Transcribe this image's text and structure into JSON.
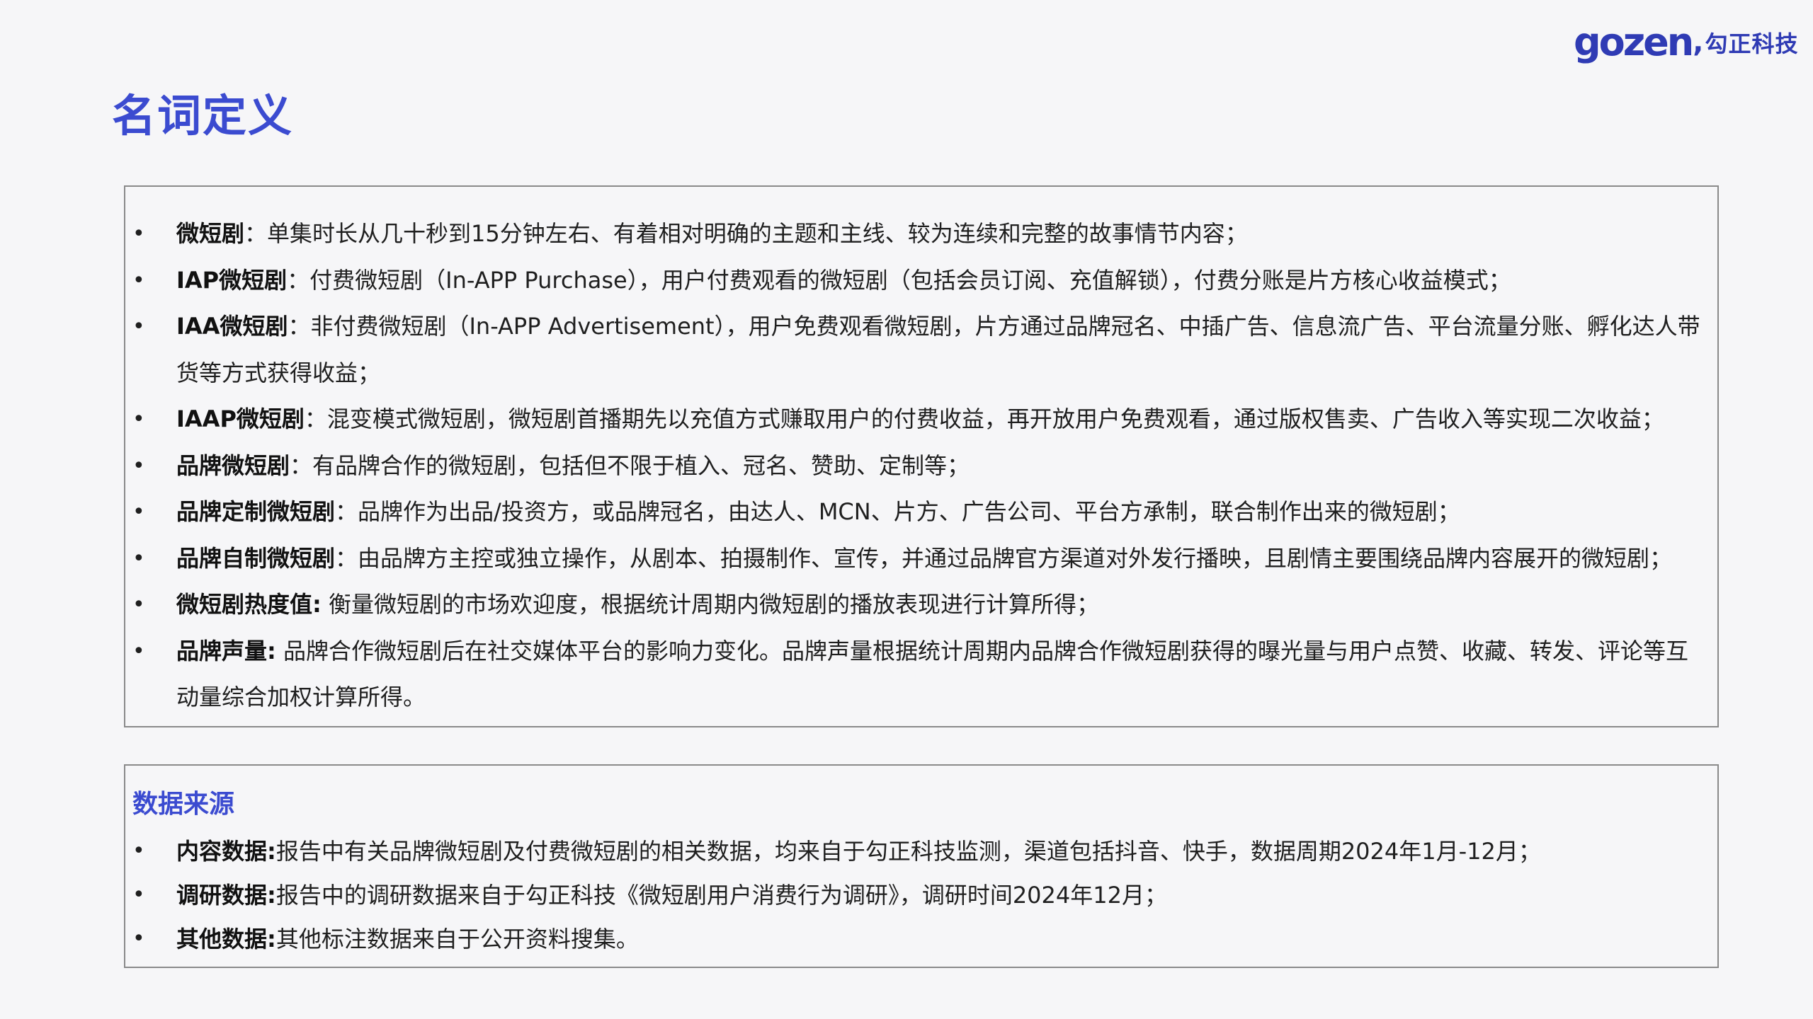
{
  "logo": {
    "mark": "gozen",
    "separator": ",",
    "cn_name": "勾正科技"
  },
  "page_title": "名词定义",
  "definitions": [
    {
      "term": "微短剧",
      "sep": "：",
      "text": "单集时长从几十秒到15分钟左右、有着相对明确的主题和主线、较为连续和完整的故事情节内容；"
    },
    {
      "term": "IAP微短剧",
      "sep": "：",
      "text": "付费微短剧（In-APP Purchase），用户付费观看的微短剧（包括会员订阅、充值解锁），付费分账是片方核心收益模式；"
    },
    {
      "term": "IAA微短剧",
      "sep": "：",
      "text": "非付费微短剧（In-APP Advertisement），用户免费观看微短剧，片方通过品牌冠名、中插广告、信息流广告、平台流量分账、孵化达人带货等方式获得收益；"
    },
    {
      "term": "IAAP微短剧",
      "sep": "：",
      "text": "混变模式微短剧，微短剧首播期先以充值方式赚取用户的付费收益，再开放用户免费观看，通过版权售卖、广告收入等实现二次收益；"
    },
    {
      "term": "品牌微短剧",
      "sep": "：",
      "text": "有品牌合作的微短剧，包括但不限于植入、冠名、赞助、定制等；"
    },
    {
      "term": "品牌定制微短剧",
      "sep": "：",
      "text": "品牌作为出品/投资方，或品牌冠名，由达人、MCN、片方、广告公司、平台方承制，联合制作出来的微短剧；"
    },
    {
      "term": "品牌自制微短剧",
      "sep": "：",
      "text": "由品牌方主控或独立操作，从剧本、拍摄制作、宣传，并通过品牌官方渠道对外发行播映，且剧情主要围绕品牌内容展开的微短剧；"
    },
    {
      "term": "微短剧热度值:",
      "sep": " ",
      "text": "衡量微短剧的市场欢迎度，根据统计周期内微短剧的播放表现进行计算所得；"
    },
    {
      "term": "品牌声量:",
      "sep": " ",
      "text": "品牌合作微短剧后在社交媒体平台的影响力变化。品牌声量根据统计周期内品牌合作微短剧获得的曝光量与用户点赞、收藏、转发、评论等互动量综合加权计算所得。"
    }
  ],
  "data_sources": {
    "title": "数据来源",
    "items": [
      {
        "term": "内容数据:",
        "text": "报告中有关品牌微短剧及付费微短剧的相关数据，均来自于勾正科技监测，渠道包括抖音、快手，数据周期2024年1月-12月；"
      },
      {
        "term": "调研数据:",
        "text": "报告中的调研数据来自于勾正科技《微短剧用户消费行为调研》，调研时间2024年12月；"
      },
      {
        "term": "其他数据:",
        "text": "其他标注数据来自于公开资料搜集。"
      }
    ]
  },
  "bullet": "•"
}
